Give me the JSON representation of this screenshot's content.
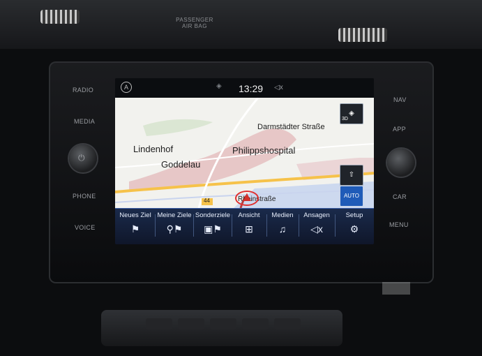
{
  "dash": {
    "airbag_line1": "PASSENGER",
    "airbag_line2": "AIR BAG"
  },
  "left_buttons": [
    "RADIO",
    "MEDIA",
    "PHONE",
    "VOICE"
  ],
  "right_buttons": [
    "NAV",
    "APP",
    "CAR",
    "MENU"
  ],
  "status": {
    "clock": "13:29"
  },
  "map": {
    "labels": {
      "darmstaedter": "Darmstädter Straße",
      "lindenhof": "Lindenhof",
      "goddelau": "Goddelau",
      "philippshospital": "Philippshospital",
      "rheinstrasse": "Rheinstraße",
      "road_sign": "44"
    },
    "compass_label": "3D",
    "auto_label": "AUTO"
  },
  "menu": {
    "items": [
      {
        "label": "Neues Ziel",
        "icon": "flag-icon"
      },
      {
        "label": "Meine Ziele",
        "icon": "person-flag-icon"
      },
      {
        "label": "Sonderziele",
        "icon": "poi-flag-icon"
      },
      {
        "label": "Ansicht",
        "icon": "map-view-icon"
      },
      {
        "label": "Medien",
        "icon": "music-note-icon"
      },
      {
        "label": "Ansagen",
        "icon": "speaker-icon"
      },
      {
        "label": "Setup",
        "icon": "gear-icon"
      }
    ]
  },
  "colors": {
    "menu_bg": "#1a2a4b",
    "map_bg": "#f2f2ee",
    "highlight": "#1f5bb8",
    "marker": "#e0302f"
  }
}
